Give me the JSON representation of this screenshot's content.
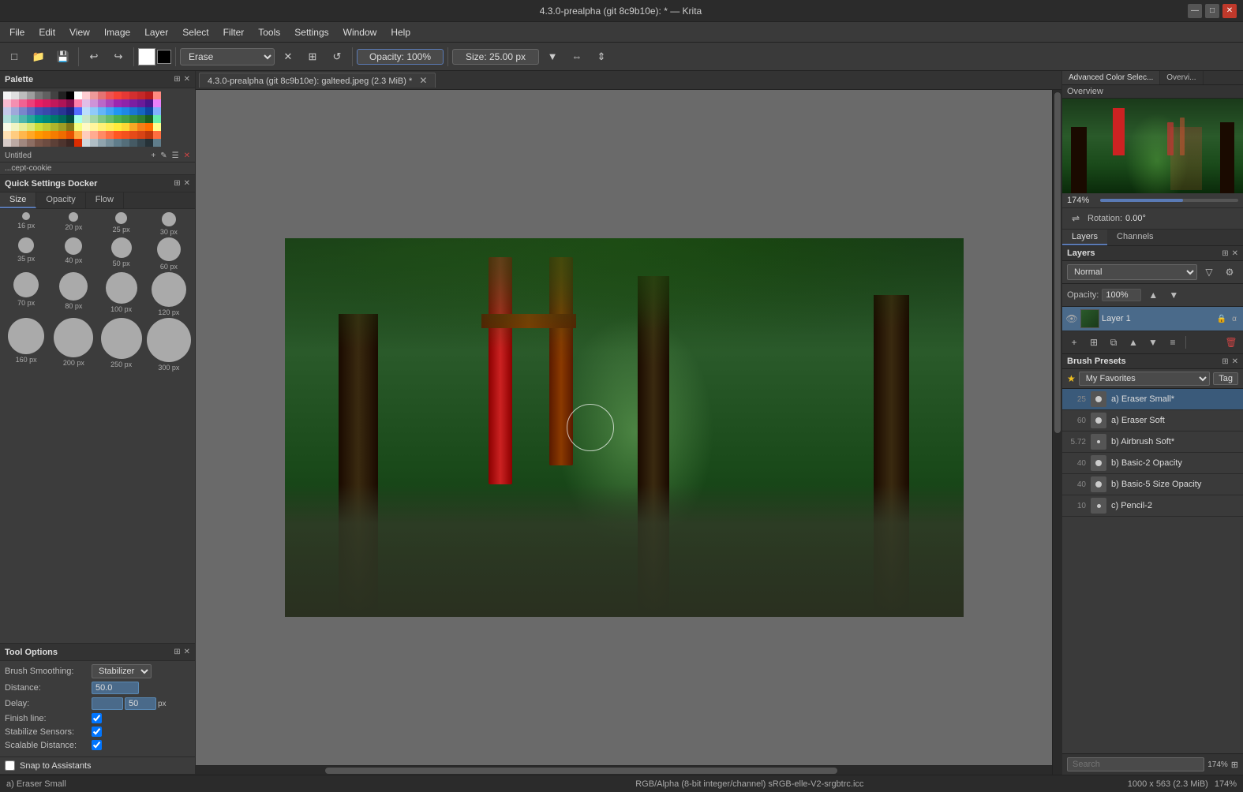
{
  "app": {
    "title": "4.3.0-prealpha (git 8c9b10e): * — Krita",
    "window_controls": {
      "minimize": "—",
      "maximize": "□",
      "close": "✕"
    }
  },
  "menu": {
    "items": [
      "File",
      "Edit",
      "View",
      "Image",
      "Layer",
      "Select",
      "Filter",
      "Tools",
      "Settings",
      "Window",
      "Help"
    ]
  },
  "toolbar": {
    "brush_preset": "Erase",
    "opacity": "Opacity: 100%",
    "size": "Size: 25.00 px"
  },
  "canvas_tab": {
    "label": "4.3.0-prealpha (git 8c9b10e): galteed.jpeg (2.3 MiB) *",
    "close": "✕"
  },
  "left_panel": {
    "palette": {
      "title": "Palette",
      "untitled_label": "Untitled"
    },
    "brush_user": "...cept-cookie",
    "quick_settings": {
      "title": "Quick Settings Docker",
      "tabs": [
        "Size",
        "Opacity",
        "Flow"
      ],
      "active_tab": "Size",
      "brush_sizes": [
        {
          "size": 16,
          "label": "16 px",
          "display": 10
        },
        {
          "size": 20,
          "label": "20 px",
          "display": 12
        },
        {
          "size": 25,
          "label": "25 px",
          "display": 15
        },
        {
          "size": 30,
          "label": "30 px",
          "display": 18
        },
        {
          "size": 35,
          "label": "35 px",
          "display": 20
        },
        {
          "size": 40,
          "label": "40 px",
          "display": 22
        },
        {
          "size": 50,
          "label": "50 px",
          "display": 26
        },
        {
          "size": 60,
          "label": "60 px",
          "display": 30
        },
        {
          "size": 70,
          "label": "70 px",
          "display": 32
        },
        {
          "size": 80,
          "label": "80 px",
          "display": 36
        },
        {
          "size": 100,
          "label": "100 px",
          "display": 40
        },
        {
          "size": 120,
          "label": "120 px",
          "display": 44
        },
        {
          "size": 160,
          "label": "160 px",
          "display": 46
        },
        {
          "size": 200,
          "label": "200 px",
          "display": 50
        },
        {
          "size": 250,
          "label": "250 px",
          "display": 52
        },
        {
          "size": 300,
          "label": "300 px",
          "display": 56
        }
      ]
    },
    "tool_options": {
      "title": "Tool Options",
      "brush_smoothing_label": "Brush Smoothing:",
      "brush_smoothing_value": "Stabilizer",
      "distance_label": "Distance:",
      "distance_value": "50.0",
      "delay_label": "Delay:",
      "delay_value": "50",
      "delay_unit": "px",
      "finish_line_label": "Finish line:",
      "stabilize_sensors_label": "Stabilize Sensors:",
      "scalable_distance_label": "Scalable Distance:"
    },
    "snap_to_assistants": {
      "label": "Snap to Assistants"
    }
  },
  "right_panel": {
    "top_tabs": [
      "Advanced Color Selec...",
      "Overvi..."
    ],
    "overview": {
      "title": "Overview"
    },
    "zoom": {
      "value": "174%",
      "rotation_label": "Rotation:",
      "rotation_value": "0.00°"
    },
    "layer_tabs": [
      "Layers",
      "Channels"
    ],
    "layers": {
      "title": "Layers",
      "blend_mode": "Normal",
      "opacity_label": "Opacity:",
      "opacity_value": "100%",
      "layer_name": "Layer 1"
    },
    "brush_presets": {
      "title": "Brush Presets",
      "favorites_label": "My Favorites",
      "tag_label": "Tag",
      "presets": [
        {
          "num": "25",
          "name": "a) Eraser Small*",
          "active": true
        },
        {
          "num": "60",
          "name": "a) Eraser Soft",
          "active": false
        },
        {
          "num": "5.72",
          "name": "b) Airbrush Soft*",
          "active": false
        },
        {
          "num": "40",
          "name": "b) Basic-2 Opacity",
          "active": false
        },
        {
          "num": "40",
          "name": "b) Basic-5 Size Opacity",
          "active": false
        },
        {
          "num": "10",
          "name": "c) Pencil-2",
          "active": false
        }
      ]
    },
    "search": {
      "placeholder": "Search",
      "zoom_value": "174%"
    }
  },
  "status_bar": {
    "brush_name": "a) Eraser Small",
    "color_profile": "RGB/Alpha (8-bit integer/channel)  sRGB-elle-V2-srgbtrc.icc",
    "image_size": "1000 x 563 (2.3 MiB)",
    "zoom": "174%"
  },
  "palette_colors": [
    "#f5f5f5",
    "#e0e0e0",
    "#bdbdbd",
    "#9e9e9e",
    "#757575",
    "#616161",
    "#424242",
    "#212121",
    "#000000",
    "#ffffff",
    "#ffcdd2",
    "#ef9a9a",
    "#e57373",
    "#ef5350",
    "#f44336",
    "#e53935",
    "#d32f2f",
    "#c62828",
    "#b71c1c",
    "#ff8a80",
    "#f8bbd0",
    "#f48fb1",
    "#f06292",
    "#ec407a",
    "#e91e63",
    "#d81b60",
    "#c2185b",
    "#ad1457",
    "#880e4f",
    "#ff80ab",
    "#e1bee7",
    "#ce93d8",
    "#ba68c8",
    "#ab47bc",
    "#9c27b0",
    "#8e24aa",
    "#7b1fa2",
    "#6a1b9a",
    "#4a148c",
    "#ea80fc",
    "#c5cae9",
    "#9fa8da",
    "#7986cb",
    "#5c6bc0",
    "#3f51b5",
    "#3949ab",
    "#303f9f",
    "#283593",
    "#1a237e",
    "#536dfe",
    "#bbdefb",
    "#90caf9",
    "#64b5f6",
    "#42a5f5",
    "#2196f3",
    "#1e88e5",
    "#1976d2",
    "#1565c0",
    "#0d47a1",
    "#82b1ff",
    "#b2dfdb",
    "#80cbc4",
    "#4db6ac",
    "#26a69a",
    "#009688",
    "#00897b",
    "#00796b",
    "#00695c",
    "#004d40",
    "#a7ffeb",
    "#c8e6c9",
    "#a5d6a7",
    "#81c784",
    "#66bb6a",
    "#4caf50",
    "#43a047",
    "#388e3c",
    "#2e7d32",
    "#1b5e20",
    "#69f0ae",
    "#f9fbe7",
    "#f0f4c3",
    "#e6ee9c",
    "#dce775",
    "#cddc39",
    "#c0ca33",
    "#afb42b",
    "#9e9d24",
    "#827717",
    "#f4ff81",
    "#fff9c4",
    "#fff59d",
    "#fff176",
    "#ffee58",
    "#ffeb3b",
    "#fdd835",
    "#f9a825",
    "#f57f17",
    "#ff6f00",
    "#ffff8d",
    "#ffe0b2",
    "#ffcc80",
    "#ffb74d",
    "#ffa726",
    "#ff9800",
    "#fb8c00",
    "#f57c00",
    "#ef6c00",
    "#e65100",
    "#ffab40",
    "#ffccbc",
    "#ffab91",
    "#ff8a65",
    "#ff7043",
    "#ff5722",
    "#f4511e",
    "#e64a19",
    "#d84315",
    "#bf360c",
    "#ff6e40",
    "#d7ccc8",
    "#bcaaa4",
    "#a1887f",
    "#8d6e63",
    "#795548",
    "#6d4c41",
    "#5d4037",
    "#4e342e",
    "#3e2723",
    "#dd2c00",
    "#cfd8dc",
    "#b0bec5",
    "#90a4ae",
    "#78909c",
    "#607d8b",
    "#546e7a",
    "#455a64",
    "#37474f",
    "#263238",
    "#607d8b"
  ]
}
